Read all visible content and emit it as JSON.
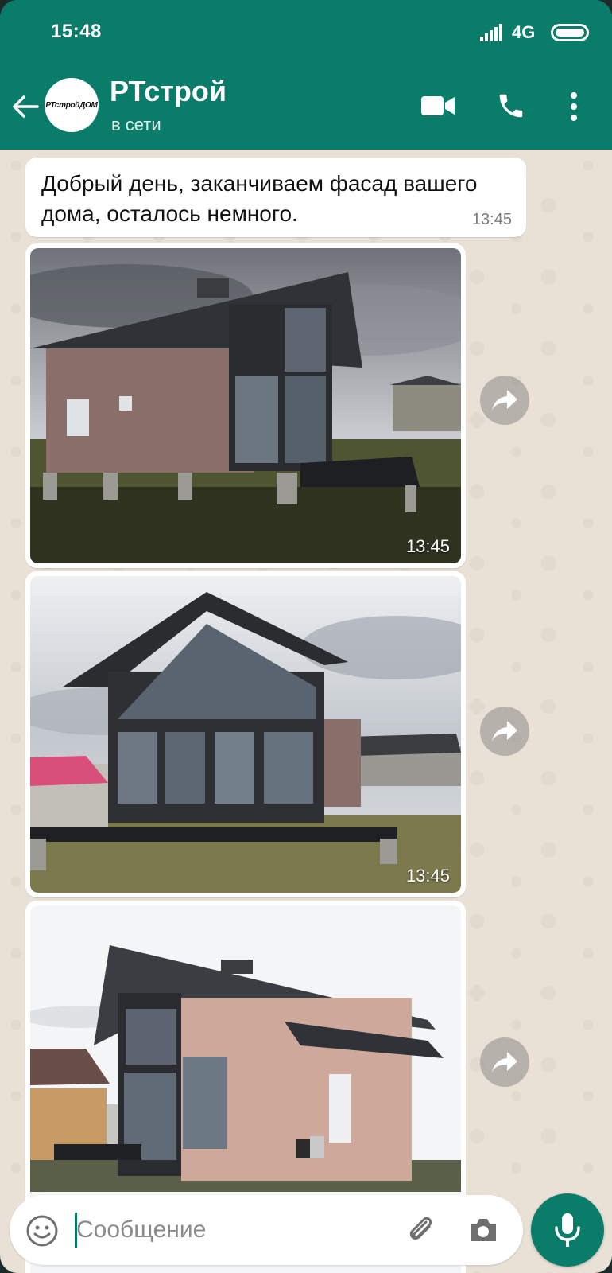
{
  "status_bar": {
    "time": "15:48",
    "network": "4G"
  },
  "header": {
    "contact_name": "РТстрой",
    "contact_status": "в сети",
    "avatar_logo_text": "РТстройДОМ"
  },
  "messages": [
    {
      "type": "text",
      "text": "Добрый день, заканчиваем фасад вашего дома, осталось немного.",
      "time": "13:45"
    },
    {
      "type": "image",
      "alt": "house-photo-1",
      "time": "13:45"
    },
    {
      "type": "image",
      "alt": "house-photo-2",
      "time": "13:45"
    },
    {
      "type": "image",
      "alt": "house-photo-3",
      "time": ""
    }
  ],
  "composer": {
    "placeholder": "Сообщение"
  },
  "colors": {
    "brand": "#0a7d6a",
    "chat_bg": "#e9e1d6",
    "bubble": "#ffffff"
  },
  "icons": [
    "back-arrow-icon",
    "video-call-icon",
    "phone-icon",
    "more-vert-icon",
    "forward-icon",
    "emoji-icon",
    "attach-icon",
    "camera-icon",
    "mic-icon"
  ]
}
